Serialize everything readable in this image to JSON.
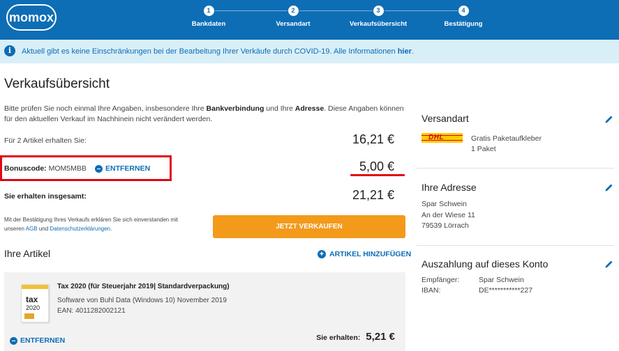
{
  "header": {
    "logo": "momox",
    "steps": [
      {
        "num": "1",
        "label": "Bankdaten"
      },
      {
        "num": "2",
        "label": "Versandart"
      },
      {
        "num": "3",
        "label": "Verkaufsübersicht"
      },
      {
        "num": "4",
        "label": "Bestätigung"
      }
    ]
  },
  "infobar": {
    "icon": "info-icon",
    "text": "Aktuell gibt es keine Einschränkungen bei der Bearbeitung Ihrer Verkäufe durch COVID-19. Alle Informationen ",
    "link": "hier",
    "suffix": "."
  },
  "main": {
    "title": "Verkaufsübersicht",
    "intro": {
      "p1": "Bitte prüfen Sie noch einmal Ihre Angaben, insbesondere Ihre ",
      "b1": "Bankverbindung",
      "p2": " und Ihre ",
      "b2": "Adresse",
      "p3": ". Diese Angaben können für den aktuellen Verkauf im Nachhinein nicht verändert werden."
    },
    "items_label": "Für 2 Artikel erhalten Sie:",
    "items_value": "16,21 €",
    "bonus": {
      "label": "Bonuscode:",
      "code": "MOM5MBB",
      "remove": "ENTFERNEN",
      "value": "5,00 €"
    },
    "total_label": "Sie erhalten insgesamt:",
    "total_value": "21,21 €",
    "legal": {
      "p1": "Mit der Bestätigung Ihres Verkaufs erklären Sie sich einverstanden mit unseren ",
      "agb": "AGB",
      "p2": " und ",
      "privacy": "Datenschutzerklärungen",
      "p3": "."
    },
    "confirm_button": "JETZT VERKAUFEN",
    "articles_title": "Ihre Artikel",
    "add_article": "ARTIKEL HINZUFÜGEN",
    "article": {
      "image_title": "tax",
      "image_year": "2020",
      "title": "Tax 2020 (für Steuerjahr 2019| Standardverpackung)",
      "line1": "Software von Buhl Data (Windows 10) November 2019",
      "line2": "EAN: 4011282002121",
      "remove": "ENTFERNEN",
      "receive_label": "Sie erhalten:",
      "receive_value": "5,21 €"
    }
  },
  "sidebar": {
    "shipping": {
      "title": "Versandart",
      "carrier": "DHL",
      "line1": "Gratis Paketaufkleber",
      "line2": "1 Paket"
    },
    "address": {
      "title": "Ihre Adresse",
      "name": "Spar Schwein",
      "street": "An der Wiese 11",
      "city": "79539 Lörrach"
    },
    "payout": {
      "title": "Auszahlung auf dieses Konto",
      "recipient_label": "Empfänger:",
      "recipient": "Spar Schwein",
      "iban_label": "IBAN:",
      "iban": "DE***********227"
    }
  },
  "colors": {
    "brand_blue": "#0d6db5",
    "button_orange": "#f39a1b",
    "highlight_red": "#e30613",
    "info_bg": "#d9eff8"
  }
}
